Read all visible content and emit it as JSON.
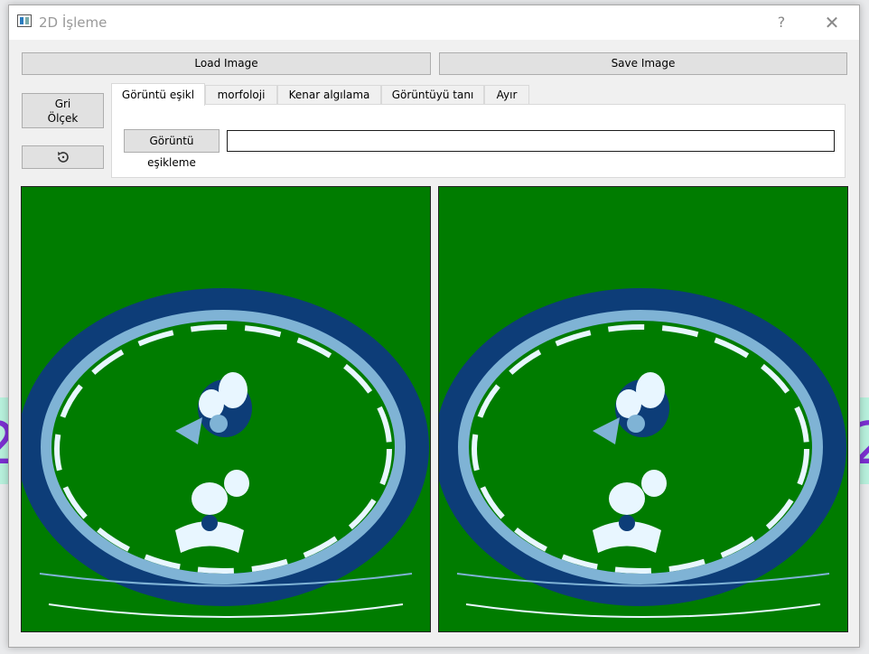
{
  "window": {
    "title": "2D İşleme",
    "help_label": "?",
    "close_label": "✕"
  },
  "toolbar": {
    "load_label": "Load Image",
    "save_label": "Save Image"
  },
  "side": {
    "gray_line1": "Gri",
    "gray_line2": "Ölçek",
    "reset_icon": "rotate-reset-icon"
  },
  "tabs": [
    {
      "label": "Görüntü eşikl",
      "active": true
    },
    {
      "label": "morfoloji"
    },
    {
      "label": "Kenar algılama"
    },
    {
      "label": "Görüntüyü tanı"
    },
    {
      "label": "Ayır"
    }
  ],
  "threshold": {
    "button_label": "Görüntü eşikleme",
    "value": ""
  },
  "images": {
    "background_color": "#007c00",
    "tone_light": "#e8f6ff",
    "tone_mid": "#7fb3d5",
    "tone_dark": "#0d3d78"
  }
}
